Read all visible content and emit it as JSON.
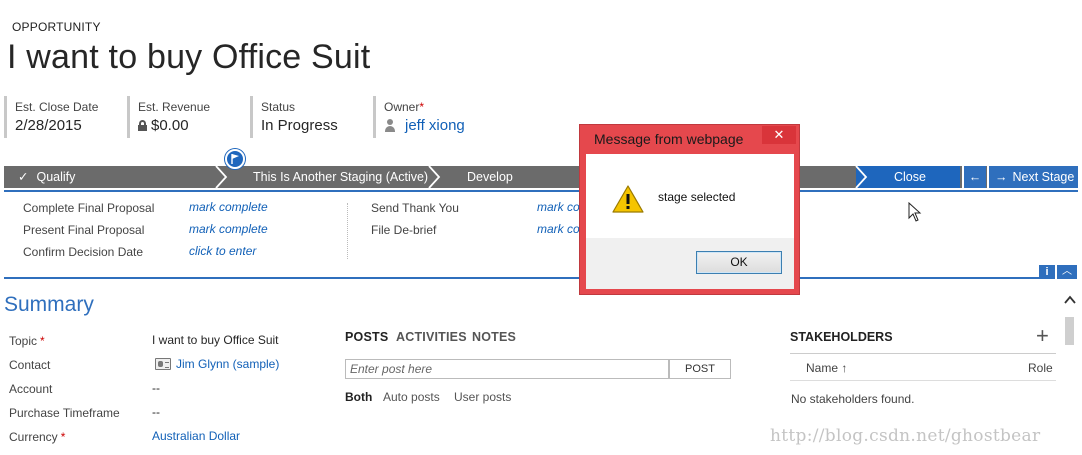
{
  "header": {
    "entity_type": "OPPORTUNITY",
    "title": "I want to buy Office Suit",
    "fields": {
      "close_date": {
        "label": "Est. Close Date",
        "value": "2/28/2015"
      },
      "revenue": {
        "label": "Est. Revenue",
        "value": "$0.00"
      },
      "status": {
        "label": "Status",
        "value": "In Progress"
      },
      "owner": {
        "label": "Owner",
        "required_mark": "*",
        "value": "jeff xiong"
      }
    }
  },
  "process": {
    "stages": [
      "Qualify",
      "This Is Another Staging (Active)",
      "Develop",
      "Close"
    ],
    "next_stage_label": "Next Stage",
    "back_glyph": "←",
    "next_glyph": "→",
    "check_glyph": "✓",
    "steps_left": [
      {
        "label": "Complete Final Proposal",
        "action": "mark complete"
      },
      {
        "label": "Present Final Proposal",
        "action": "mark complete"
      },
      {
        "label": "Confirm Decision Date",
        "action": "click to enter"
      }
    ],
    "steps_right": [
      {
        "label": "Send Thank You",
        "action": "mark complete"
      },
      {
        "label": "File De-brief",
        "action": "mark complete"
      }
    ],
    "info_glyph": "i",
    "collapse_glyph": "︿"
  },
  "summary": {
    "title": "Summary",
    "fields": [
      {
        "label": "Topic",
        "required_mark": "*",
        "value": "I want to buy Office Suit"
      },
      {
        "label": "Contact",
        "value": "Jim Glynn (sample)"
      },
      {
        "label": "Account",
        "value": "--"
      },
      {
        "label": "Purchase Timeframe",
        "value": "--"
      },
      {
        "label": "Currency",
        "required_mark": "*",
        "value": "Australian Dollar"
      }
    ]
  },
  "social": {
    "tabs": [
      "POSTS",
      "ACTIVITIES",
      "NOTES"
    ],
    "post_placeholder": "Enter post here",
    "post_button": "POST",
    "filters": [
      "Both",
      "Auto posts",
      "User posts"
    ]
  },
  "stakeholders": {
    "title": "STAKEHOLDERS",
    "add_glyph": "+",
    "columns": [
      "Name ↑",
      "Role"
    ],
    "empty_text": "No stakeholders found."
  },
  "dialog": {
    "title": "Message from webpage",
    "close_glyph": "✕",
    "message": "stage selected",
    "ok_label": "OK"
  },
  "watermark": "http://blog.csdn.net/ghostbear",
  "colors": {
    "accent": "#2f6fbd",
    "active_stage": "#1e66bd",
    "inactive_stage": "#6b6b6b",
    "dialog_frame": "#e5484d",
    "link": "#1160b7"
  },
  "icons": [
    "lock-icon",
    "user-icon",
    "check-icon",
    "flag-icon",
    "arrow-left-icon",
    "arrow-right-icon",
    "info-icon",
    "chevron-up-icon",
    "contact-card-icon",
    "plus-icon",
    "warning-icon",
    "close-icon",
    "cursor-icon"
  ]
}
